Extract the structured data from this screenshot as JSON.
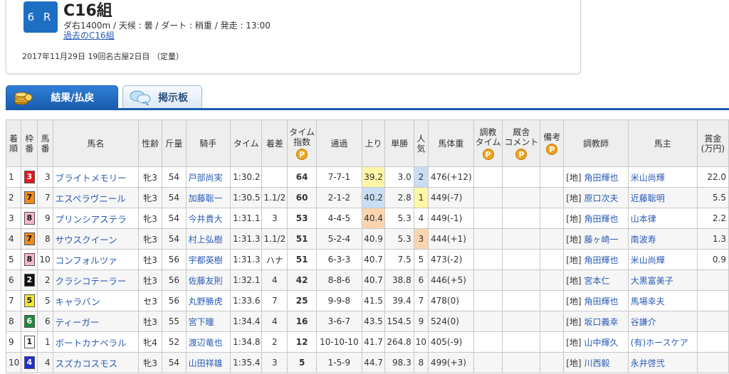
{
  "race": {
    "number": "6 R",
    "name": "C16組",
    "conditions": "ダ右1400m / 天候 : 曇 / ダート : 稍重 / 発走 : 13:00",
    "past_link": "過去のC16組",
    "date": "2017年11月29日 19回名古屋2日目 （定量）"
  },
  "tabs": {
    "result": "結果/払戻",
    "board": "掲示板"
  },
  "columns": {
    "rank": [
      "着",
      "順"
    ],
    "waku": [
      "枠",
      "番"
    ],
    "umaban": [
      "馬",
      "番"
    ],
    "horse": "馬名",
    "sex_age": "性齢",
    "weight": "斤量",
    "jockey": "騎手",
    "time": "タイム",
    "margin": "着差",
    "time_index": [
      "タイム",
      "指数"
    ],
    "passing": "通過",
    "last3f": "上り",
    "odds": "単勝",
    "popularity": [
      "人",
      "気"
    ],
    "body_weight": "馬体重",
    "training_time": [
      "調教",
      "タイム"
    ],
    "stable_comment": [
      "厩舎",
      "コメント"
    ],
    "remarks": "備考",
    "trainer": "調教師",
    "owner": "馬主",
    "prize": [
      "賞金",
      "(万円)"
    ],
    "p_badge": "P"
  },
  "rows": [
    {
      "rank": "1",
      "waku": "3",
      "umaban": "3",
      "horse": "ブライトメモリー",
      "sex_age": "牝3",
      "weight": "54",
      "jockey": "戸部尚実",
      "time": "1:30.2",
      "margin": "",
      "index": "64",
      "passing": "7-7-1",
      "last3f": "39.2",
      "odds": "3.0",
      "popularity": "2",
      "body_weight": "476(+12)",
      "trainer_region": "[地]",
      "trainer": "角田輝也",
      "owner": "米山尚輝",
      "prize": "22.0"
    },
    {
      "rank": "2",
      "waku": "7",
      "umaban": "7",
      "horse": "エスペラヴニール",
      "sex_age": "牝3",
      "weight": "54",
      "jockey": "加藤聡一",
      "time": "1:30.5",
      "margin": "1.1/2",
      "index": "60",
      "passing": "2-1-2",
      "last3f": "40.2",
      "odds": "2.8",
      "popularity": "1",
      "body_weight": "449(-7)",
      "trainer_region": "[地]",
      "trainer": "原口次夫",
      "owner": "近藤聡明",
      "prize": "5.5"
    },
    {
      "rank": "3",
      "waku": "8",
      "umaban": "9",
      "horse": "プリンシアステラ",
      "sex_age": "牝3",
      "weight": "54",
      "jockey": "今井貴大",
      "time": "1:31.1",
      "margin": "3",
      "index": "53",
      "passing": "4-4-5",
      "last3f": "40.4",
      "odds": "5.3",
      "popularity": "4",
      "body_weight": "449(-1)",
      "trainer_region": "[地]",
      "trainer": "角田輝也",
      "owner": "山本律",
      "prize": "2.2"
    },
    {
      "rank": "4",
      "waku": "7",
      "umaban": "8",
      "horse": "サウスクイーン",
      "sex_age": "牝3",
      "weight": "54",
      "jockey": "村上弘樹",
      "time": "1:31.3",
      "margin": "1.1/2",
      "index": "51",
      "passing": "5-2-4",
      "last3f": "40.9",
      "odds": "5.3",
      "popularity": "3",
      "body_weight": "444(+1)",
      "trainer_region": "[地]",
      "trainer": "藤ヶ崎一",
      "owner": "南波寿",
      "prize": "1.3"
    },
    {
      "rank": "5",
      "waku": "8",
      "umaban": "10",
      "horse": "コンフォルツァ",
      "sex_age": "牡3",
      "weight": "56",
      "jockey": "宇都英樹",
      "time": "1:31.3",
      "margin": "ハナ",
      "index": "51",
      "passing": "6-3-3",
      "last3f": "40.7",
      "odds": "7.5",
      "popularity": "5",
      "body_weight": "473(-2)",
      "trainer_region": "[地]",
      "trainer": "角田輝也",
      "owner": "米山尚輝",
      "prize": "0.9"
    },
    {
      "rank": "6",
      "waku": "2",
      "umaban": "2",
      "horse": "クラシコテーラー",
      "sex_age": "牡3",
      "weight": "56",
      "jockey": "佐藤友則",
      "time": "1:32.1",
      "margin": "4",
      "index": "42",
      "passing": "8-8-6",
      "last3f": "40.7",
      "odds": "38.8",
      "popularity": "6",
      "body_weight": "446(+5)",
      "trainer_region": "[地]",
      "trainer": "宮本仁",
      "owner": "大黒富美子",
      "prize": ""
    },
    {
      "rank": "7",
      "waku": "5",
      "umaban": "5",
      "horse": "キャラバン",
      "sex_age": "セ3",
      "weight": "56",
      "jockey": "丸野勝虎",
      "time": "1:33.6",
      "margin": "7",
      "index": "25",
      "passing": "9-9-8",
      "last3f": "41.5",
      "odds": "39.4",
      "popularity": "7",
      "body_weight": "478(0)",
      "trainer_region": "[地]",
      "trainer": "角田輝也",
      "owner": "馬場幸夫",
      "prize": ""
    },
    {
      "rank": "8",
      "waku": "6",
      "umaban": "6",
      "horse": "ティーガー",
      "sex_age": "牡3",
      "weight": "55",
      "jockey": "宮下瞳",
      "time": "1:34.4",
      "margin": "4",
      "index": "16",
      "passing": "3-6-7",
      "last3f": "43.5",
      "odds": "154.5",
      "popularity": "9",
      "body_weight": "524(0)",
      "trainer_region": "[地]",
      "trainer": "坂口義幸",
      "owner": "谷謙介",
      "prize": ""
    },
    {
      "rank": "9",
      "waku": "1",
      "umaban": "1",
      "horse": "ボートカナベラル",
      "sex_age": "牝4",
      "weight": "52",
      "jockey": "渡辺竜也",
      "time": "1:34.8",
      "margin": "2",
      "index": "12",
      "passing": "10-10-10",
      "last3f": "41.7",
      "odds": "264.8",
      "popularity": "10",
      "body_weight": "405(-9)",
      "trainer_region": "[地]",
      "trainer": "山中輝久",
      "owner": "(有)ホースケア",
      "prize": ""
    },
    {
      "rank": "10",
      "waku": "4",
      "umaban": "4",
      "horse": "スズカコスモス",
      "sex_age": "牝3",
      "weight": "54",
      "jockey": "山田祥雄",
      "time": "1:35.4",
      "margin": "3",
      "index": "5",
      "passing": "1-5-9",
      "last3f": "44.7",
      "odds": "98.3",
      "popularity": "8",
      "body_weight": "499(+3)",
      "trainer_region": "[地]",
      "trainer": "川西毅",
      "owner": "永井啓弐",
      "prize": ""
    }
  ],
  "colors": {
    "waku_bg": {
      "1": "#ffffff",
      "2": "#111111",
      "3": "#e8141c",
      "4": "#1f2fd0",
      "5": "#f5e82a",
      "6": "#1c8a3a",
      "7": "#f08a1c",
      "8": "#f6b7c6"
    },
    "waku_fg": {
      "1": "#111111",
      "2": "#ffffff",
      "3": "#ffffff",
      "4": "#ffffff",
      "5": "#111111",
      "6": "#ffffff",
      "7": "#111111",
      "8": "#111111"
    },
    "accent": "#1a5cae",
    "link": "#2a5bb5"
  },
  "icons": {
    "tab_result": "coin-stack-icon",
    "tab_board": "speech-bubble-icon",
    "p_badge": "premium-badge-icon"
  }
}
